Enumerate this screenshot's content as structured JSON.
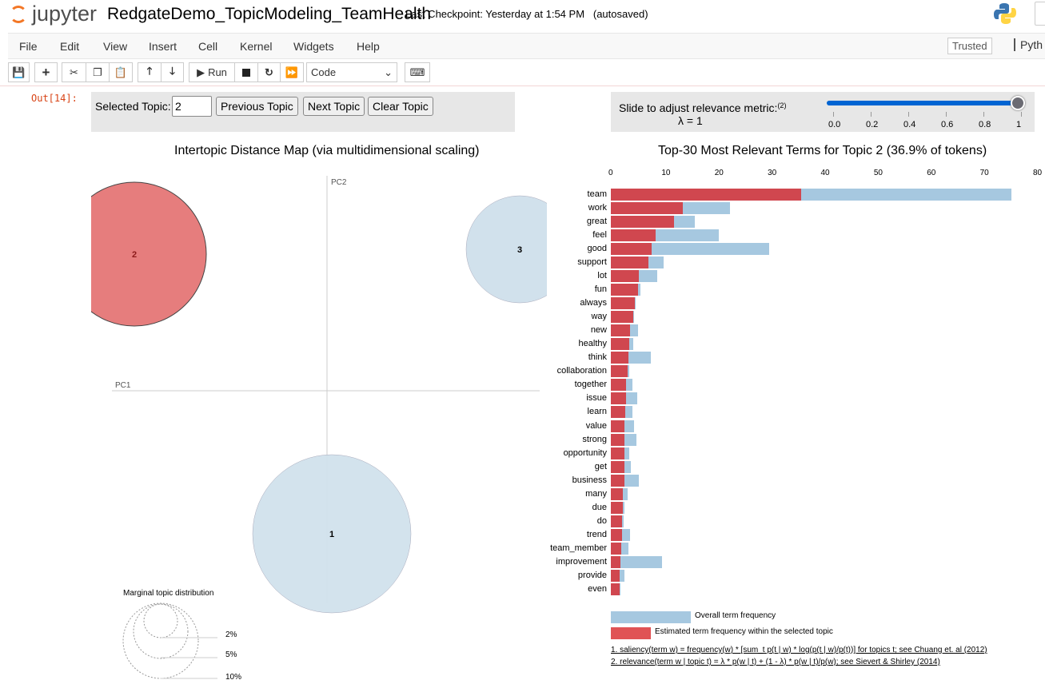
{
  "header": {
    "logo_text": "jupyter",
    "notebook_title": "RedgateDemo_TopicModeling_TeamHealth",
    "checkpoint": "Last Checkpoint: Yesterday at 1:54 PM",
    "autosave": "(autosaved)"
  },
  "menu": {
    "items": [
      "File",
      "Edit",
      "View",
      "Insert",
      "Cell",
      "Kernel",
      "Widgets",
      "Help"
    ],
    "trusted": "Trusted",
    "kernel": "Pyth"
  },
  "toolbar": {
    "run_label": "Run",
    "cell_type": "Code",
    "icons": [
      "save-icon",
      "plus-icon",
      "cut-icon",
      "copy-icon",
      "paste-icon",
      "arrow-up-icon",
      "arrow-down-icon",
      "run-icon",
      "stop-icon",
      "restart-icon",
      "fast-forward-icon",
      "keyboard-icon"
    ]
  },
  "cell": {
    "prompt": "Out[14]:"
  },
  "topic_controls": {
    "label": "Selected Topic:",
    "value": "2",
    "previous": "Previous Topic",
    "next": "Next Topic",
    "clear": "Clear Topic"
  },
  "lambda_controls": {
    "label": "Slide to adjust relevance metric:",
    "footnote": "(2)",
    "lambda_text": "λ = 1",
    "value": 1,
    "ticks": [
      "0.0",
      "0.2",
      "0.4",
      "0.6",
      "0.8",
      "1"
    ],
    "accent": "#0064d2"
  },
  "map": {
    "title": "Intertopic Distance Map (via multidimensional scaling)",
    "pc1": "PC1",
    "pc2": "PC2",
    "topics": [
      {
        "label": "1",
        "selected": false
      },
      {
        "label": "2",
        "selected": true
      },
      {
        "label": "3",
        "selected": false
      }
    ],
    "selected_color": "#e67d7d",
    "default_color": "#d1e1ec",
    "marginal": {
      "title": "Marginal topic distribution",
      "labels": [
        "2%",
        "5%",
        "10%"
      ]
    }
  },
  "chart_data": {
    "type": "bar",
    "title": "Top-30 Most Relevant Terms for Topic 2 (36.9% of tokens)",
    "orientation": "horizontal",
    "xlim": [
      0,
      80
    ],
    "x_ticks": [
      "0",
      "10",
      "20",
      "30",
      "40",
      "50",
      "60",
      "70",
      "80"
    ],
    "categories": [
      "team",
      "work",
      "great",
      "feel",
      "good",
      "support",
      "lot",
      "fun",
      "always",
      "way",
      "new",
      "healthy",
      "think",
      "collaboration",
      "together",
      "issue",
      "learn",
      "value",
      "strong",
      "opportunity",
      "get",
      "business",
      "many",
      "due",
      "do",
      "trend",
      "team_member",
      "improvement",
      "provide",
      "even"
    ],
    "series": [
      {
        "name": "Overall term frequency",
        "color": "#a6c8e0",
        "values": [
          75.5,
          22.4,
          15.8,
          20.4,
          29.8,
          9.9,
          8.7,
          5.6,
          4.7,
          4.3,
          5.1,
          4.2,
          7.5,
          3.4,
          4.1,
          5.0,
          4.0,
          4.3,
          4.8,
          3.4,
          3.7,
          5.2,
          3.1,
          2.5,
          2.4,
          3.6,
          3.3,
          9.6,
          2.6,
          1.8
        ]
      },
      {
        "name": "Estimated term frequency within the selected topic",
        "color": "#d0474f",
        "values": [
          35.9,
          13.5,
          11.9,
          8.4,
          7.7,
          7.1,
          5.2,
          5.1,
          4.5,
          4.2,
          3.6,
          3.5,
          3.3,
          3.2,
          2.9,
          2.9,
          2.7,
          2.6,
          2.6,
          2.6,
          2.5,
          2.5,
          2.3,
          2.2,
          2.1,
          2.1,
          2.0,
          1.8,
          1.7,
          1.7
        ]
      }
    ],
    "legend_colors": [
      "#a6c8e0",
      "#e05355"
    ]
  },
  "footnotes": [
    "1. saliency(term w) = frequency(w) * [sum_t p(t | w) * log(p(t | w)/p(t))] for topics t; see Chuang et. al (2012)",
    "2. relevance(term w | topic t) = λ * p(w | t) + (1 - λ) * p(w | t)/p(w); see Sievert & Shirley (2014)"
  ]
}
